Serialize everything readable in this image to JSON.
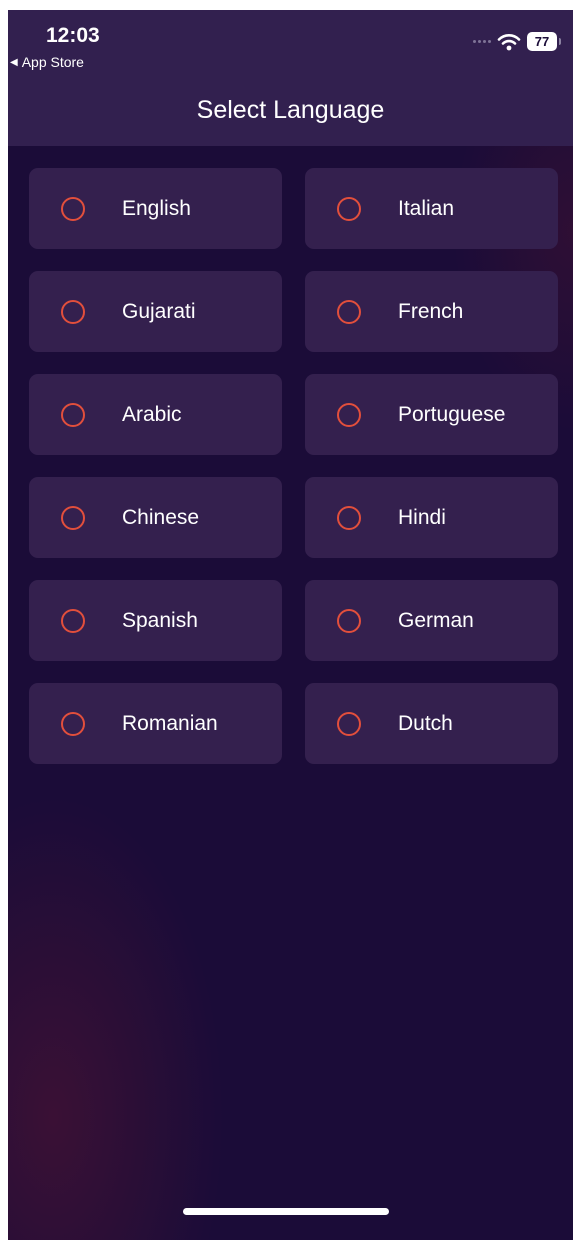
{
  "status_bar": {
    "time": "12:03",
    "back_label": "App Store",
    "battery": "77"
  },
  "header": {
    "title": "Select Language"
  },
  "languages": [
    {
      "label": "English",
      "selected": false
    },
    {
      "label": "Italian",
      "selected": false
    },
    {
      "label": "Gujarati",
      "selected": false
    },
    {
      "label": "French",
      "selected": false
    },
    {
      "label": "Arabic",
      "selected": false
    },
    {
      "label": "Portuguese",
      "selected": false
    },
    {
      "label": "Chinese",
      "selected": false
    },
    {
      "label": "Hindi",
      "selected": false
    },
    {
      "label": "Spanish",
      "selected": false
    },
    {
      "label": "German",
      "selected": false
    },
    {
      "label": "Romanian",
      "selected": false
    },
    {
      "label": "Dutch",
      "selected": false
    }
  ],
  "colors": {
    "background": "#1b0c38",
    "header": "#32204f",
    "card": "#34204e",
    "radio_accent": "#e24f3c",
    "text": "#ffffff"
  },
  "icons": {
    "back": "back-triangle-icon",
    "signal": "signal-dots-icon",
    "wifi": "wifi-icon",
    "battery": "battery-icon",
    "radio": "radio-unchecked-icon"
  }
}
